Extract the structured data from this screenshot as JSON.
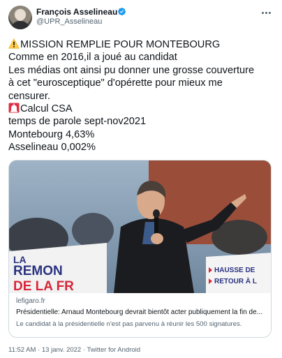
{
  "author": {
    "name": "François Asselineau",
    "handle": "@UPR_Asselineau",
    "verified": true
  },
  "tweet": {
    "lines": [
      "MISSION REMPLIE POUR MONTEBOURG",
      "Comme en 2016,il a joué au candidat",
      "Les médias ont ainsi pu donner une grosse couverture",
      "à cet \"eurosceptique\" d'opérette pour mieux me",
      "censurer.",
      "Calcul CSA",
      "temps de parole sept-nov2021",
      "Montebourg 4,63%",
      "Asselineau 0,002%"
    ],
    "leading_icons": {
      "0": "warning-icon",
      "5": "siren-icon"
    }
  },
  "link_card": {
    "image_banner_left": [
      "LA",
      "REMON",
      "DE LA FR"
    ],
    "image_banner_right": [
      "HAUSSE DE",
      "RETOUR À L"
    ],
    "domain": "lefigaro.fr",
    "title": "Présidentielle: Arnaud Montebourg devrait bientôt acter publiquement la fin de...",
    "description": "Le candidat à la présidentielle n'est pas parvenu à réunir les 500 signatures."
  },
  "meta": {
    "timestamp": "11:52 AM · 13 janv. 2022 · Twitter for Android"
  },
  "colors": {
    "text": "#0f1419",
    "secondary": "#536471",
    "verified": "#1d9bf0",
    "border": "#cfd9de"
  }
}
